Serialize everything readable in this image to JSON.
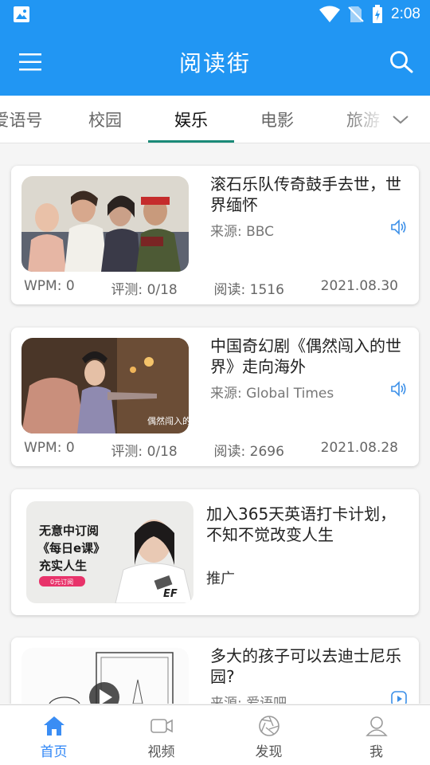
{
  "status_bar": {
    "time": "2:08"
  },
  "app_bar": {
    "title": "阅读街"
  },
  "tabs": [
    {
      "label": "爱语号"
    },
    {
      "label": "校园"
    },
    {
      "label": "娱乐"
    },
    {
      "label": "电影"
    },
    {
      "label": "旅游"
    }
  ],
  "active_tab": "娱乐",
  "articles": [
    {
      "title": "滚石乐队传奇鼓手去世，世界缅怀",
      "source": "来源: BBC",
      "wpm": "WPM: 0",
      "evaluation": "评测: 0/18",
      "reads": "阅读: 1516",
      "date": "2021.08.30",
      "media_icon": "speaker-icon"
    },
    {
      "title": "中国奇幻剧《偶然闯入的世界》走向海外",
      "source": "来源: Global Times",
      "wpm": "WPM: 0",
      "evaluation": "评测: 0/18",
      "reads": "阅读: 2696",
      "date": "2021.08.28",
      "media_icon": "speaker-icon",
      "image_caption": "偶然闯入的世界"
    },
    {
      "title": "多大的孩子可以去迪士尼乐园?",
      "source": "来源: 爱语吧",
      "media_icon": "video-play-icon"
    }
  ],
  "ad": {
    "title": "加入365天英语打卡计划，不知不觉改变人生",
    "tag": "推广",
    "image_lines": [
      "无意中订阅",
      "《每日e课》",
      "充实人生"
    ],
    "image_button": "0元订阅",
    "image_logo": "EF"
  },
  "bottom_nav": [
    {
      "label": "首页",
      "icon": "home-icon",
      "active": true
    },
    {
      "label": "视频",
      "icon": "video-camera-icon",
      "active": false
    },
    {
      "label": "发现",
      "icon": "aperture-icon",
      "active": false
    },
    {
      "label": "我",
      "icon": "user-icon",
      "active": false
    }
  ],
  "colors": {
    "primary": "#2196f3",
    "tab_indicator": "#1b8a78",
    "nav_active": "#2f86f6",
    "ad_badge": "#e8336a"
  }
}
